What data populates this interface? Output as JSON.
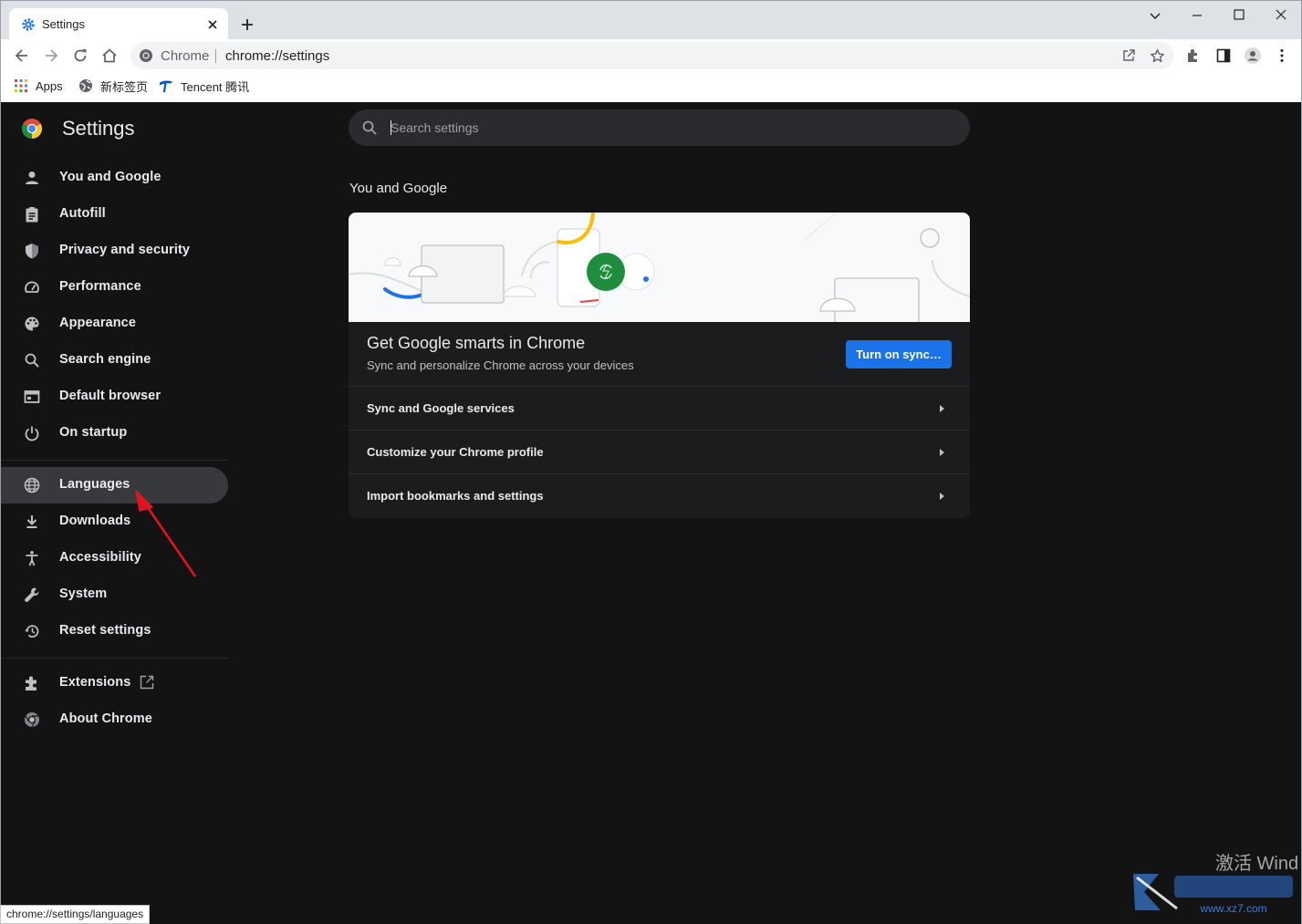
{
  "browser": {
    "tab_title": "Settings",
    "omnibox_site": "Chrome",
    "omnibox_url": "chrome://settings",
    "bookmarks": [
      {
        "label": "Apps",
        "icon": "apps-grid-icon"
      },
      {
        "label": "新标签页",
        "icon": "globe-icon"
      },
      {
        "label": "Tencent 腾讯",
        "icon": "tencent-icon"
      }
    ]
  },
  "settings": {
    "title": "Settings",
    "search_placeholder": "Search settings",
    "nav": [
      {
        "label": "You and Google",
        "icon": "person-icon"
      },
      {
        "label": "Autofill",
        "icon": "clipboard-icon"
      },
      {
        "label": "Privacy and security",
        "icon": "shield-icon"
      },
      {
        "label": "Performance",
        "icon": "speedometer-icon"
      },
      {
        "label": "Appearance",
        "icon": "palette-icon"
      },
      {
        "label": "Search engine",
        "icon": "search-icon"
      },
      {
        "label": "Default browser",
        "icon": "browser-window-icon"
      },
      {
        "label": "On startup",
        "icon": "power-icon"
      },
      {
        "label": "Languages",
        "icon": "globe-icon",
        "active": true
      },
      {
        "label": "Downloads",
        "icon": "download-icon"
      },
      {
        "label": "Accessibility",
        "icon": "accessibility-icon"
      },
      {
        "label": "System",
        "icon": "wrench-icon"
      },
      {
        "label": "Reset settings",
        "icon": "history-icon"
      },
      {
        "label": "Extensions",
        "icon": "puzzle-icon"
      },
      {
        "label": "About Chrome",
        "icon": "chrome-icon"
      }
    ],
    "section_title": "You and Google",
    "promo_title": "Get Google smarts in Chrome",
    "promo_subtitle": "Sync and personalize Chrome across your devices",
    "sync_button": "Turn on sync…",
    "rows": [
      "Sync and Google services",
      "Customize your Chrome profile",
      "Import bookmarks and settings"
    ]
  },
  "status_bar": "chrome://settings/languages",
  "watermark": {
    "text": "激活 Wind",
    "site": "www.xz7.com"
  },
  "colors": {
    "accent": "#1a73e8",
    "page_bg": "#131314",
    "active_nav": "#37393d",
    "annotation_arrow": "#e0141e"
  }
}
